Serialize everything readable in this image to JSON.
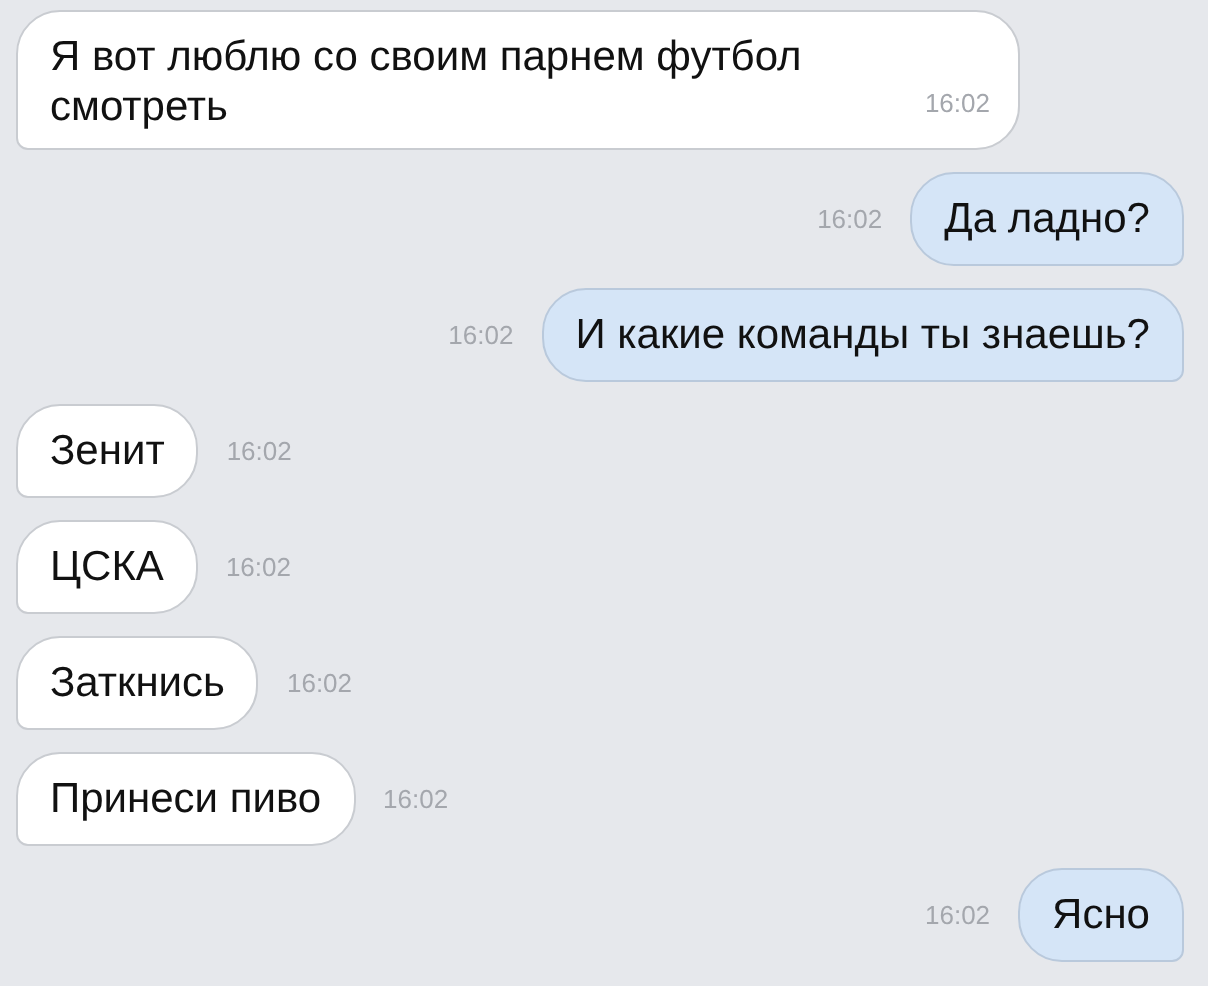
{
  "messages": [
    {
      "outgoing": false,
      "kind": "long",
      "text": "Я вот люблю со своим парнем футбол смотреть",
      "time": "16:02"
    },
    {
      "outgoing": true,
      "kind": "short",
      "text": "Да ладно?",
      "time": "16:02"
    },
    {
      "outgoing": true,
      "kind": "short",
      "text": "И какие команды ты знаешь?",
      "time": "16:02"
    },
    {
      "outgoing": false,
      "kind": "short",
      "text": "Зенит",
      "time": "16:02"
    },
    {
      "outgoing": false,
      "kind": "short",
      "text": "ЦСКА",
      "time": "16:02"
    },
    {
      "outgoing": false,
      "kind": "short",
      "text": "Заткнись",
      "time": "16:02"
    },
    {
      "outgoing": false,
      "kind": "short",
      "text": "Принеси пиво",
      "time": "16:02"
    },
    {
      "outgoing": true,
      "kind": "short",
      "text": "Ясно",
      "time": "16:02"
    }
  ]
}
